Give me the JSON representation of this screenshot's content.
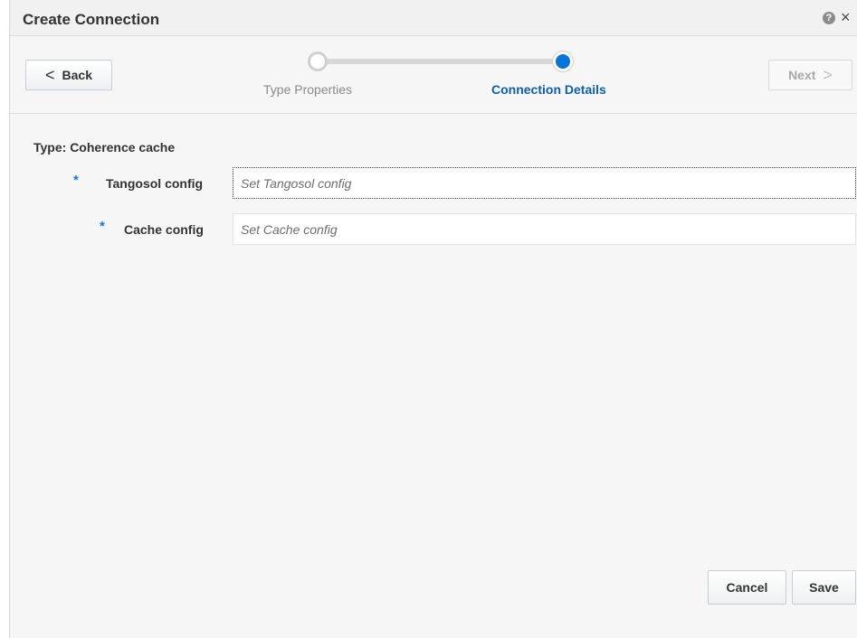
{
  "dialog": {
    "title": "Create Connection",
    "help_icon": "question-circle-icon",
    "help_glyph": "?",
    "close_icon": "close-icon",
    "close_glyph": "×"
  },
  "train": {
    "back_label": "Back",
    "back_chevron": "<",
    "next_label": "Next",
    "next_chevron": ">",
    "stops": [
      {
        "label": "Type Properties",
        "state": "visited"
      },
      {
        "label": "Connection Details",
        "state": "current"
      }
    ],
    "accent_color": "#0a73d8"
  },
  "form": {
    "type_line": "Type: Coherence cache",
    "required_marker": "*",
    "fields": [
      {
        "label": "Tangosol config",
        "value": "",
        "placeholder": "Set Tangosol config"
      },
      {
        "label": "Cache config",
        "value": "",
        "placeholder": "Set Cache config"
      }
    ]
  },
  "footer": {
    "cancel_label": "Cancel",
    "save_label": "Save"
  }
}
